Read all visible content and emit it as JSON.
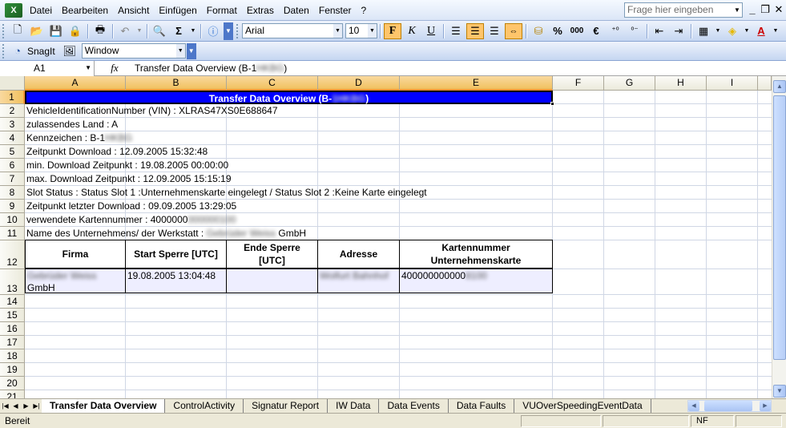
{
  "menubar": {
    "items": [
      "Datei",
      "Bearbeiten",
      "Ansicht",
      "Einfügen",
      "Format",
      "Extras",
      "Daten",
      "Fenster",
      "?"
    ],
    "ask_placeholder": "Frage hier eingeben"
  },
  "toolbar": {
    "font_name": "Arial",
    "font_size": "10",
    "bold_label": "F",
    "italic_label": "K",
    "underline_label": "U",
    "percent_label": "%",
    "thousands_label": "000",
    "euro_label": "€",
    "snagit_label": "SnagIt",
    "window_label": "Window"
  },
  "formula_bar": {
    "cell_ref": "A1",
    "fx_label": "fx",
    "content": "Transfer Data Overview (B-1",
    "content_blur": "HKBG",
    "content_end": ")"
  },
  "columns": [
    "A",
    "B",
    "C",
    "D",
    "E",
    "F",
    "G",
    "H",
    "I"
  ],
  "rows": [
    "1",
    "2",
    "3",
    "4",
    "5",
    "6",
    "7",
    "8",
    "9",
    "10",
    "11",
    "12",
    "13",
    "14",
    "15",
    "16",
    "17",
    "18",
    "19",
    "20",
    "21"
  ],
  "sheet": {
    "title": "Transfer Data Overview (B-",
    "title_blur": "1HKBG",
    "title_end": ")",
    "r2": "VehicleIdentificationNumber (VIN) : XLRAS47XS0E688647",
    "r3": "zulassendes Land : A",
    "r4_a": "Kennzeichen : B-1",
    "r4_blur": "HKBG",
    "r5": "Zeitpunkt Download : 12.09.2005 15:32:48",
    "r6": "min. Download Zeitpunkt : 19.08.2005 00:00:00",
    "r7": "max. Download Zeitpunkt : 12.09.2005 15:15:19",
    "r8": "Slot Status : Status Slot 1 :Unternehmenskarte eingelegt / Status Slot 2 :Keine Karte eingelegt",
    "r9": "Zeitpunkt letzter Download : 09.09.2005 13:29:05",
    "r10_a": "verwendete Kartennummer : 4000000",
    "r10_blur": "000000100",
    "r11_a": "Name des Unternehmens/ der Werkstatt : ",
    "r11_blur": "Gebrüder Weiss",
    "r11_b": " GmbH",
    "table_headers": [
      "Firma",
      "Start Sperre [UTC]",
      "Ende Sperre [UTC]",
      "Adresse",
      "Kartennummer Unternehmenskarte"
    ],
    "row13": {
      "firma_blur": "Gebrüder Weiss",
      "firma_end": "GmbH",
      "start": "19.08.2005 13:04:48",
      "ende": "",
      "adresse_blur": "Wolfurt Bahnhof",
      "karten": "400000000000",
      "karten_blur": "8100"
    }
  },
  "tabs": [
    "Transfer Data Overview",
    "ControlActivity",
    "Signatur Report",
    "IW Data",
    "Data Events",
    "Data Faults",
    "VUOverSpeedingEventData"
  ],
  "status": {
    "ready": "Bereit",
    "nf": "NF"
  }
}
